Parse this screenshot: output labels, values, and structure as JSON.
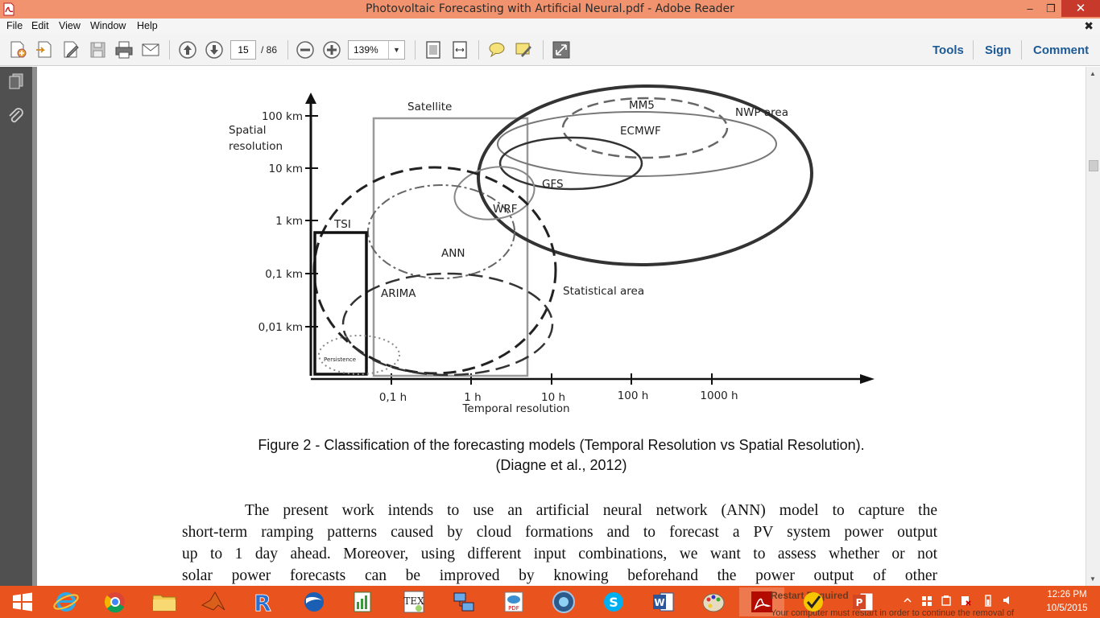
{
  "window": {
    "title": "Photovoltaic Forecasting with Artificial Neural.pdf - Adobe Reader",
    "min": "–",
    "max": "❐",
    "close": "✕",
    "doc_close": "✖"
  },
  "menu": [
    "File",
    "Edit",
    "View",
    "Window",
    "Help"
  ],
  "toolbar": {
    "page_current": "15",
    "page_total": "/ 86",
    "zoom": "139%",
    "zoom_arrow": "▼",
    "tools": "Tools",
    "sign": "Sign",
    "comment": "Comment"
  },
  "figure": {
    "y_axis_title_1": "Spatial",
    "y_axis_title_2": "resolution",
    "y_ticks": [
      "100 km",
      "10 km",
      "1 km",
      "0,1 km",
      "0,01 km"
    ],
    "x_ticks": [
      "0,1 h",
      "1 h",
      "10 h",
      "100 h",
      "1000 h"
    ],
    "x_axis_title": "Temporal resolution",
    "labels": {
      "satellite": "Satellite",
      "nwp_area": "NWP area",
      "mm5": "MM5",
      "ecmwf": "ECMWF",
      "gfs": "GFS",
      "wrf": "WRF",
      "ann": "ANN",
      "tsi": "TSI",
      "arima": "ARIMA",
      "statistical_area": "Statistical area",
      "persistence": "Persistence"
    },
    "caption_1": "Figure 2 - Classification of the forecasting models (Temporal Resolution vs Spatial Resolution).",
    "caption_2": "(Diagne et al., 2012)"
  },
  "body_text": [
    "The present work intends to use an artificial neural network (ANN) model to capture the",
    "short-term ramping patterns caused by cloud formations and to forecast a PV system power output",
    "up to 1 day ahead. Moreover, using different input combinations, we want to assess whether or not",
    "solar power forecasts can be improved by knowing beforehand the power output of other"
  ],
  "notification": {
    "title": "Restart Required",
    "body": "Your computer must restart in order to continue the removal of"
  },
  "clock": {
    "time": "12:26 PM",
    "date": "10/5/2015"
  },
  "colors": {
    "titlebar": "#f0936e",
    "taskbar": "#e9541e",
    "link_blue": "#1d5a95"
  }
}
